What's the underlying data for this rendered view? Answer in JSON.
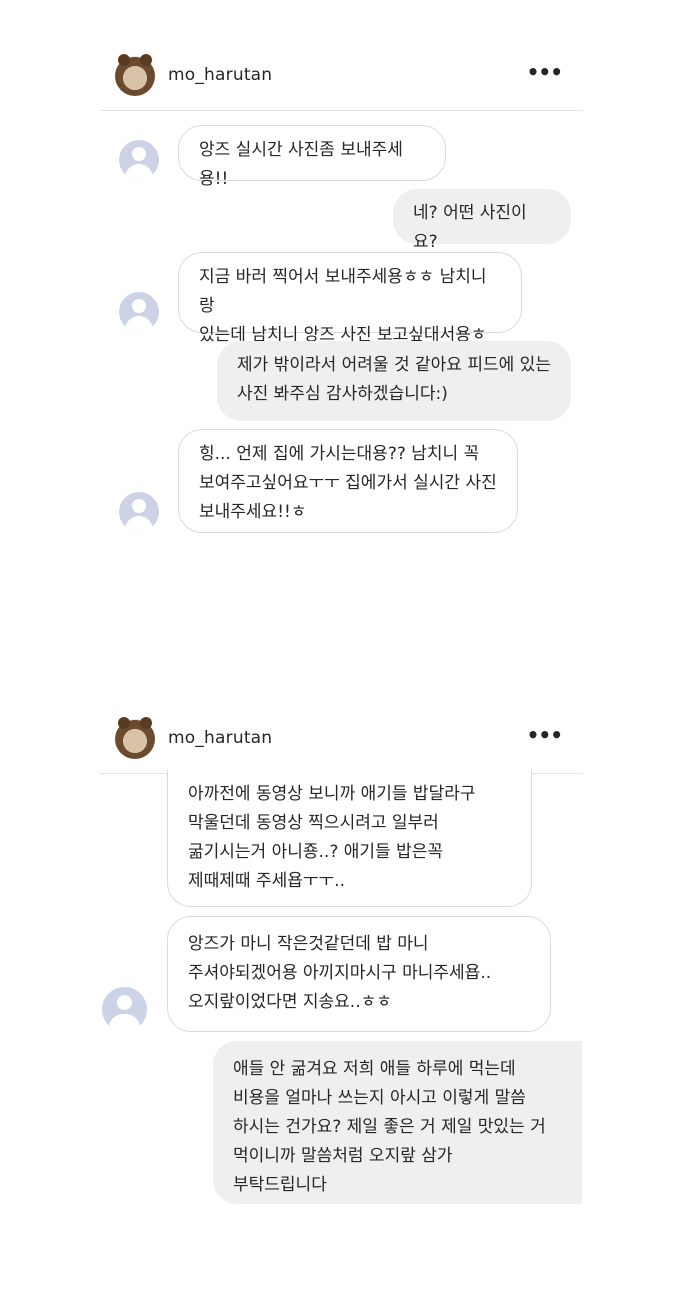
{
  "screens": [
    {
      "header": {
        "username": "mo_harutan",
        "more_label": "•••",
        "avatar_icon": "profile-photo-icon"
      },
      "messages": [
        {
          "side": "received",
          "text": "앙즈 실시간 사진좀 보내주세용!!"
        },
        {
          "side": "sent",
          "text": "네? 어떤 사진이요?"
        },
        {
          "side": "received",
          "text": "지금 바러 찍어서 보내주세용ㅎㅎ 남치니랑\n있는데 남치니 앙즈 사진 보고싶대서용ㅎ"
        },
        {
          "side": "sent",
          "text": "제가 밖이라서 어려울 것 같아요 피드에 있는\n사진 봐주심 감사하겠습니다:)"
        },
        {
          "side": "received",
          "text": "힝... 언제 집에 가시는대용?? 남치니 꼭\n보여주고싶어요ㅜㅜ 집에가서 실시간 사진\n보내주세요!!ㅎ"
        }
      ]
    },
    {
      "header": {
        "username": "mo_harutan",
        "more_label": "•••",
        "avatar_icon": "profile-photo-icon"
      },
      "messages": [
        {
          "side": "received",
          "text": "아까전에 동영상 보니까 애기들 밥달라구\n막울던데 동영상 찍으시려고 일부러\n굶기시는거 아니죵..? 애기들 밥은꼭\n제때제때 주세욥ㅜㅜ.."
        },
        {
          "side": "received",
          "text": "앙즈가 마니 작은것같던데 밥 마니\n주셔야되겠어용 아끼지마시구 마니주세욥..\n오지랖이었다면 지송요..ㅎㅎ"
        },
        {
          "side": "sent",
          "text": "애들 안 굶겨요 저희 애들 하루에 먹는데\n비용을 얼마나 쓰는지 아시고 이렇게 말씀\n하시는 건가요? 제일 좋은 거 제일 맛있는 거\n먹이니까 말씀처럼 오지랖 삼가\n부탁드립니다"
        }
      ]
    }
  ],
  "colors": {
    "received_border": "#dbdbdb",
    "sent_bg": "#efefef",
    "avatar_placeholder": "#ccd3e6",
    "divider": "#e3e3e3"
  }
}
